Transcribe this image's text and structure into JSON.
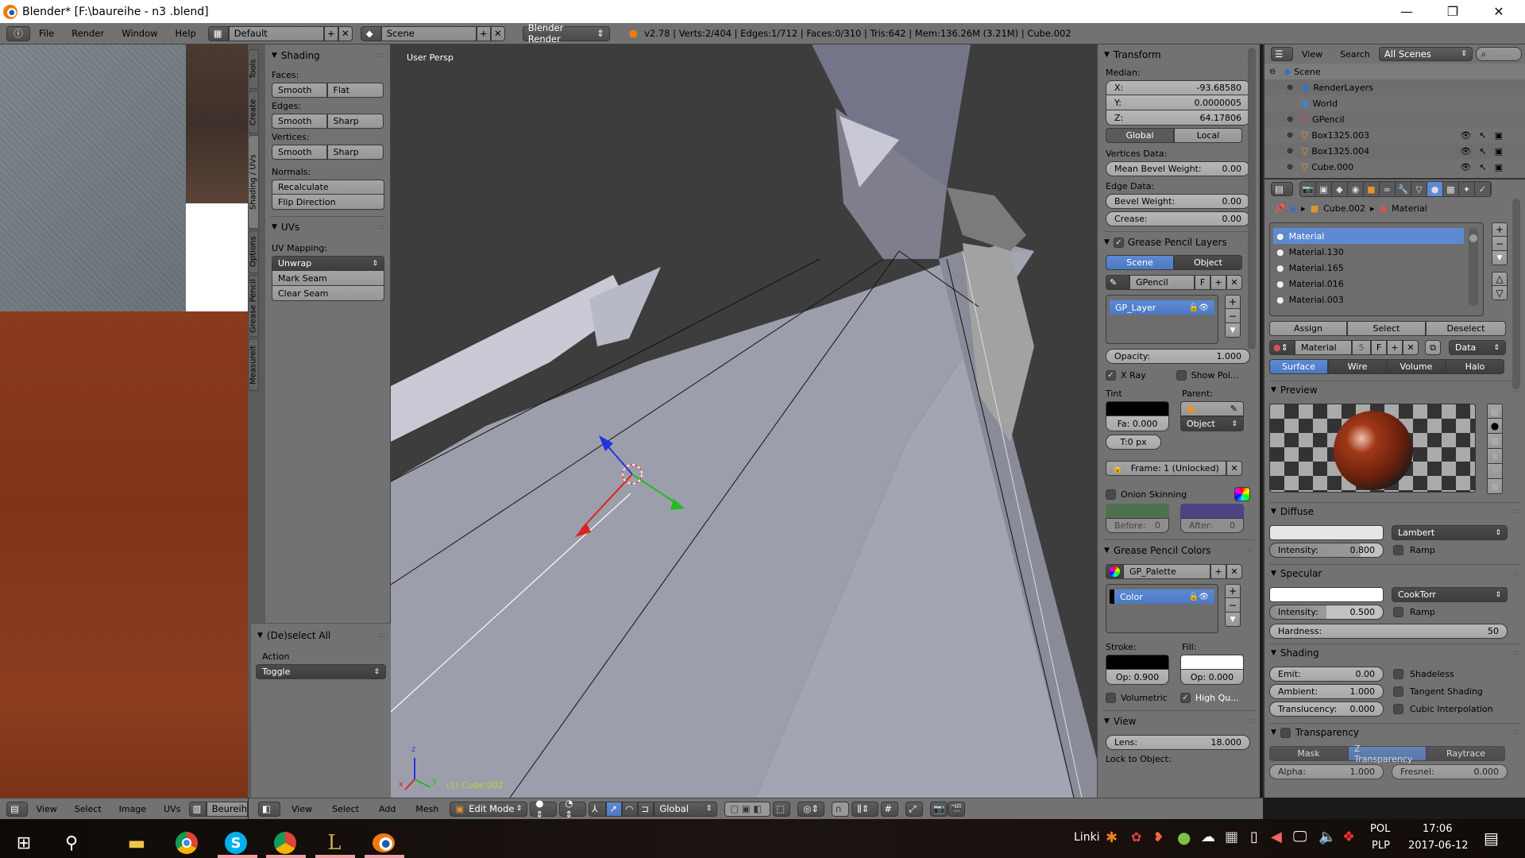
{
  "window": {
    "title": "Blender* [F:\\baureihe - n3 .blend]",
    "controls": {
      "minimize": "—",
      "maximize": "❐",
      "close": "✕"
    }
  },
  "info_header": {
    "menus": [
      "File",
      "Render",
      "Window",
      "Help"
    ],
    "screen_layout": "Default",
    "scene": "Scene",
    "render_engine": "Blender Render",
    "stats": "v2.78 | Verts:2/404 | Edges:1/712 | Faces:0/310 | Tris:642 | Mem:136.26M (3.21M) | Cube.002"
  },
  "tool_tabs": [
    "Tools",
    "Create",
    "Shading / UVs",
    "Options",
    "Grease Pencil",
    "Measureit"
  ],
  "active_tool_tab": "Shading / UVs",
  "tool_shelf": {
    "shading": {
      "title": "Shading",
      "faces_label": "Faces:",
      "faces": [
        "Smooth",
        "Flat"
      ],
      "edges_label": "Edges:",
      "edges": [
        "Smooth",
        "Sharp"
      ],
      "vertices_label": "Vertices:",
      "vertices": [
        "Smooth",
        "Sharp"
      ],
      "normals_label": "Normals:",
      "normals": [
        "Recalculate",
        "Flip Direction"
      ]
    },
    "uvs": {
      "title": "UVs",
      "mapping_label": "UV Mapping:",
      "mapping_value": "Unwrap",
      "buttons": [
        "Mark Seam",
        "Clear Seam"
      ]
    },
    "operator": {
      "title": "(De)select All",
      "action_label": "Action",
      "action_value": "Toggle"
    }
  },
  "viewport": {
    "view_name": "User Persp",
    "object_label": "(1) Cube.002",
    "axis_labels": {
      "x": "x",
      "y": "y",
      "z": "z"
    }
  },
  "properties_n": {
    "transform": {
      "title": "Transform",
      "median_label": "Median:",
      "x": {
        "label": "X:",
        "value": "-93.68580"
      },
      "y": {
        "label": "Y:",
        "value": "0.0000005"
      },
      "z": {
        "label": "Z:",
        "value": "64.17806"
      },
      "space": [
        "Global",
        "Local"
      ],
      "active_space": "Global",
      "vertices_data_label": "Vertices Data:",
      "mean_bevel_weight": {
        "label": "Mean Bevel Weight:",
        "value": "0.00"
      },
      "edge_data_label": "Edge Data:",
      "bevel_weight": {
        "label": "Bevel Weight:",
        "value": "0.00"
      },
      "crease": {
        "label": "Crease:",
        "value": "0.00"
      }
    },
    "gp_layers": {
      "title": "Grease Pencil Layers",
      "enabled": true,
      "source": [
        "Scene",
        "Object"
      ],
      "active_source": "Scene",
      "datablock": "GPencil",
      "fake_user": "F",
      "layers": [
        "GP_Layer"
      ],
      "opacity": {
        "label": "Opacity:",
        "value": "1.000"
      },
      "xray": {
        "label": "X Ray",
        "checked": true
      },
      "show_points": {
        "label": "Show Poi...",
        "checked": false
      },
      "tint_label": "Tint",
      "tint_factor": "Fa: 0.000",
      "thickness": "T:0 px",
      "parent_label": "Parent:",
      "parent_type": "Object",
      "frame": "Frame: 1 (Unlocked)",
      "onion_skinning": {
        "label": "Onion Skinning",
        "checked": false
      },
      "before": {
        "label": "Before:",
        "value": "0"
      },
      "after": {
        "label": "After:",
        "value": "0"
      },
      "before_color": "#4e7150",
      "after_color": "#4c4480"
    },
    "gp_colors": {
      "title": "Grease Pencil Colors",
      "palette": "GP_Palette",
      "colors": [
        "Color"
      ],
      "stroke_label": "Stroke:",
      "stroke_opacity": "Op: 0.900",
      "fill_label": "Fill:",
      "fill_opacity": "Op: 0.000",
      "volumetric": {
        "label": "Volumetric",
        "checked": false
      },
      "high_quality": {
        "label": "High Qu...",
        "checked": true
      }
    },
    "view": {
      "title": "View",
      "lens": {
        "label": "Lens:",
        "value": "18.000"
      },
      "lock_label": "Lock to Object:"
    }
  },
  "outliner": {
    "menus": [
      "View",
      "Search"
    ],
    "filter": "All Scenes",
    "items": [
      {
        "name": "Scene",
        "icon": "scene-icon",
        "level": 0
      },
      {
        "name": "RenderLayers",
        "icon": "render-layers-icon",
        "level": 1
      },
      {
        "name": "World",
        "icon": "world-icon",
        "level": 1
      },
      {
        "name": "GPencil",
        "icon": "pencil-icon",
        "level": 1
      },
      {
        "name": "Box1325.003",
        "icon": "mesh-icon",
        "level": 1
      },
      {
        "name": "Box1325.004",
        "icon": "mesh-icon",
        "level": 1
      },
      {
        "name": "Cube.000",
        "icon": "mesh-icon",
        "level": 1
      }
    ]
  },
  "properties": {
    "breadcrumb": [
      "Cube.002",
      "Material"
    ],
    "tabs": [
      "render-icon",
      "render-layers-icon",
      "scene-icon",
      "world-icon",
      "object-icon",
      "constraints-icon",
      "modifiers-icon",
      "data-icon",
      "material-icon",
      "texture-icon",
      "particles-icon",
      "physics-icon"
    ],
    "active_tab": "material-icon",
    "material_slots": [
      "Material",
      "Material.130",
      "Material.165",
      "Material.016",
      "Material.003"
    ],
    "slot_buttons": [
      "Assign",
      "Select",
      "Deselect"
    ],
    "material_name": "Material",
    "users": "5",
    "fake_user": "F",
    "link": "Data",
    "type_tabs": [
      "Surface",
      "Wire",
      "Volume",
      "Halo"
    ],
    "active_type": "Surface",
    "preview": {
      "title": "Preview"
    },
    "diffuse": {
      "title": "Diffuse",
      "shader": "Lambert",
      "intensity": {
        "label": "Intensity:",
        "value": "0.800",
        "fraction": 0.8
      },
      "ramp": "Ramp",
      "color": "#e6e6e6"
    },
    "specular": {
      "title": "Specular",
      "shader": "CookTorr",
      "intensity": {
        "label": "Intensity:",
        "value": "0.500",
        "fraction": 0.5
      },
      "ramp": "Ramp",
      "hardness": {
        "label": "Hardness:",
        "value": "50"
      },
      "color": "#ffffff"
    },
    "shading": {
      "title": "Shading",
      "emit": {
        "label": "Emit:",
        "value": "0.00"
      },
      "ambient": {
        "label": "Ambient:",
        "value": "1.000"
      },
      "translucency": {
        "label": "Translucency:",
        "value": "0.000"
      },
      "shadeless": "Shadeless",
      "tangent": "Tangent Shading",
      "cubic": "Cubic Interpolation"
    },
    "transparency": {
      "title": "Transparency",
      "modes": [
        "Mask",
        "Z Transparency",
        "Raytrace"
      ],
      "active_mode": "Z Transparency",
      "alpha": {
        "label": "Alpha:",
        "value": "1.000"
      },
      "fresnel": {
        "label": "Fresnel:",
        "value": "0.000"
      }
    }
  },
  "uv_header": {
    "menus": [
      "View",
      "Select",
      "Image",
      "UVs"
    ],
    "image": "Beureihe"
  },
  "view3d_header": {
    "menus": [
      "View",
      "Select",
      "Add",
      "Mesh"
    ],
    "mode": "Edit Mode",
    "orientation": "Global"
  },
  "taskbar": {
    "apps": [
      "windows-start-icon",
      "search-icon",
      "file-explorer-icon",
      "chrome-icon",
      "skype-icon",
      "chrome-profile-icon",
      "league-icon",
      "blender-icon"
    ],
    "links_label": "Linki",
    "lang": "POL",
    "layout": "PLP",
    "time": "17:06",
    "date": "2017-06-12"
  }
}
